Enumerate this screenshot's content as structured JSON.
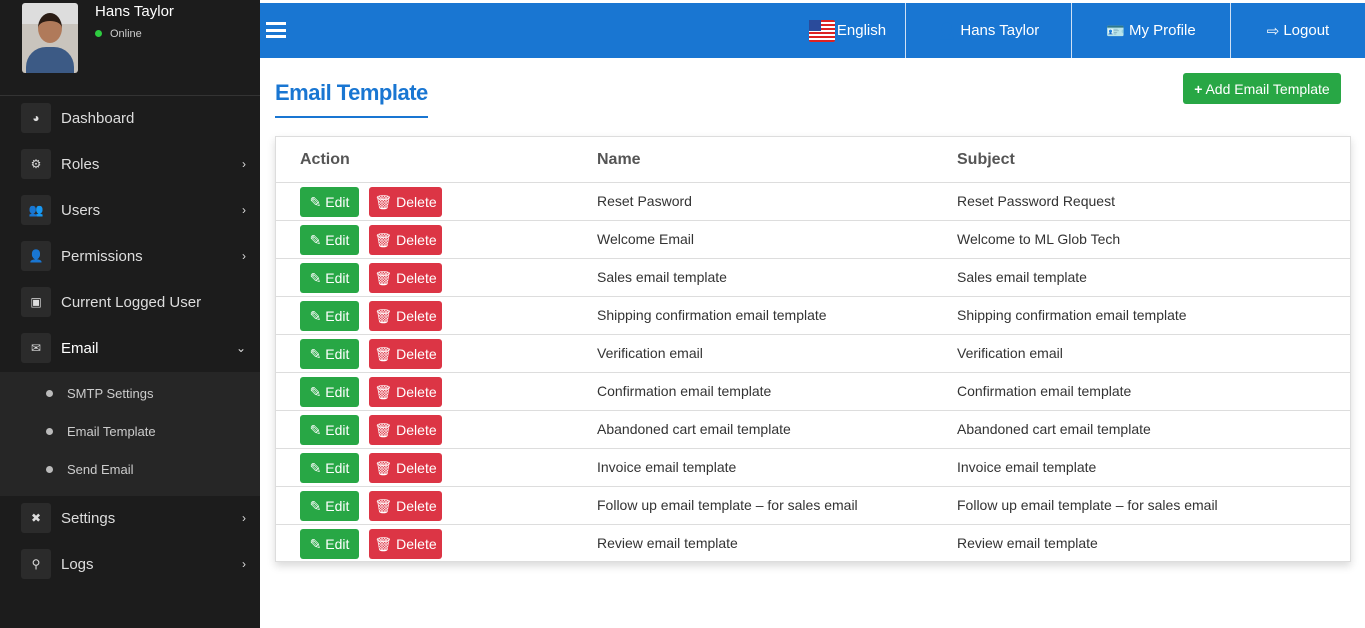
{
  "user": {
    "name": "Hans Taylor",
    "status": "Online"
  },
  "sidebar": {
    "items": [
      {
        "label": "Dashboard",
        "icon": "dashboard-icon",
        "glyph": "◕",
        "chev": false
      },
      {
        "label": "Roles",
        "icon": "roles-icon",
        "glyph": "⚙",
        "chev": true
      },
      {
        "label": "Users",
        "icon": "users-icon",
        "glyph": "👥",
        "chev": true
      },
      {
        "label": "Permissions",
        "icon": "permissions-icon",
        "glyph": "👤",
        "chev": true
      },
      {
        "label": "Current Logged User",
        "icon": "monitor-user-icon",
        "glyph": "▣",
        "chev": false
      },
      {
        "label": "Email",
        "icon": "email-icon",
        "glyph": "✉",
        "chev": true,
        "open": true
      },
      {
        "label": "Settings",
        "icon": "tools-icon",
        "glyph": "✖",
        "chev": true
      },
      {
        "label": "Logs",
        "icon": "search-icon",
        "glyph": "⚲",
        "chev": true
      }
    ],
    "submenu": [
      "SMTP Settings",
      "Email Template",
      "Send Email"
    ]
  },
  "topbar": {
    "language": "English",
    "user": "Hans Taylor",
    "profile": "My Profile",
    "logout": "Logout"
  },
  "page": {
    "title": "Email Template",
    "add_button": "Add Email Template"
  },
  "table": {
    "headers": [
      "Action",
      "Name",
      "Subject"
    ],
    "edit_label": "Edit",
    "delete_label": "Delete",
    "rows": [
      [
        "Reset Pasword",
        "Reset Password Request"
      ],
      [
        "Welcome Email",
        "Welcome to ML Glob Tech"
      ],
      [
        "Sales email template",
        "Sales email template"
      ],
      [
        "Shipping confirmation email template",
        "Shipping confirmation email template"
      ],
      [
        "Verification email",
        "Verification email"
      ],
      [
        "Confirmation email template",
        "Confirmation email template"
      ],
      [
        "Abandoned cart email template",
        "Abandoned cart email template"
      ],
      [
        "Invoice email template",
        "Invoice email template"
      ],
      [
        "Follow up email template – for sales email",
        "Follow up email template – for sales email"
      ],
      [
        "Review email template",
        "Review email template"
      ]
    ]
  },
  "colors": {
    "primary": "#1976d2",
    "success": "#28a745",
    "danger": "#dc3545",
    "sidebar": "#1c1c1c"
  }
}
